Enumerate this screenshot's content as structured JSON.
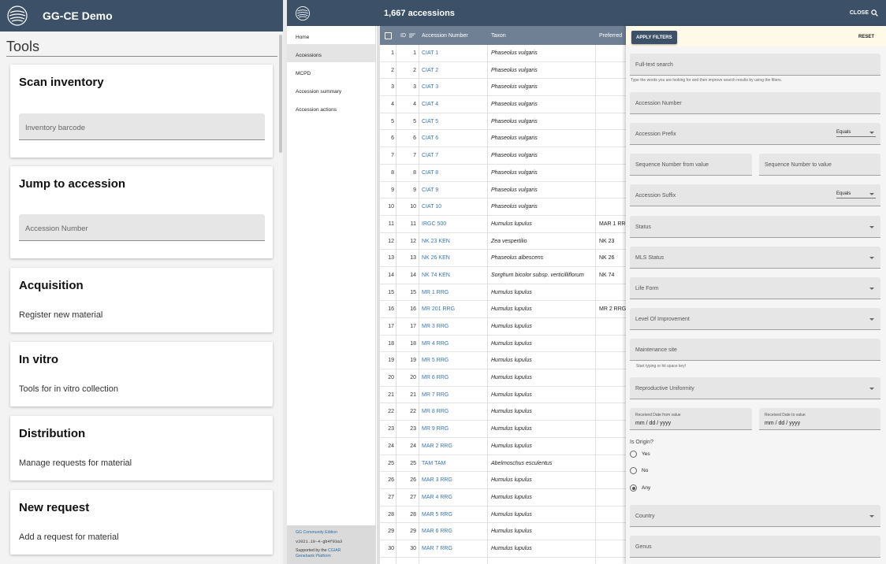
{
  "left": {
    "app_title": "GG-CE Demo",
    "section_title": "Tools",
    "cards": [
      {
        "title": "Scan inventory",
        "field_placeholder": "Inventory barcode"
      },
      {
        "title": "Jump to accession",
        "field_placeholder": "Accession Number"
      },
      {
        "title": "Acquisition",
        "subtitle": "Register new material"
      },
      {
        "title": "In vitro",
        "subtitle": "Tools for in vitro collection"
      },
      {
        "title": "Distribution",
        "subtitle": "Manage requests for material"
      },
      {
        "title": "New request",
        "subtitle": "Add a request for material"
      }
    ]
  },
  "right": {
    "accession_count": "1,667 accessions",
    "close_label": "CLOSE",
    "nav": [
      "Home",
      "Accessions",
      "MCPD",
      "Accession summary",
      "Accession actions"
    ],
    "footer": {
      "edition": "GG Community Edition",
      "version": "v2021.10-4-gb4f93a3",
      "supported_prefix": "Supported by the",
      "supported_accent": "CGIAR",
      "supported_line2": "Genebank Platform"
    },
    "table": {
      "headers": {
        "id": "ID",
        "accession": "Accession Number",
        "taxon": "Taxon",
        "preferred": "Preferred"
      },
      "rows": [
        {
          "n": "1",
          "id": "1",
          "acc": "CIAT 1",
          "taxon": "Phaseolus vulgaris",
          "pref": ""
        },
        {
          "n": "2",
          "id": "2",
          "acc": "CIAT 2",
          "taxon": "Phaseolus vulgaris",
          "pref": ""
        },
        {
          "n": "3",
          "id": "3",
          "acc": "CIAT 3",
          "taxon": "Phaseolus vulgaris",
          "pref": ""
        },
        {
          "n": "4",
          "id": "4",
          "acc": "CIAT 4",
          "taxon": "Phaseolus vulgaris",
          "pref": ""
        },
        {
          "n": "5",
          "id": "5",
          "acc": "CIAT 5",
          "taxon": "Phaseolus vulgaris",
          "pref": ""
        },
        {
          "n": "6",
          "id": "6",
          "acc": "CIAT 6",
          "taxon": "Phaseolus vulgaris",
          "pref": ""
        },
        {
          "n": "7",
          "id": "7",
          "acc": "CIAT 7",
          "taxon": "Phaseolus vulgaris",
          "pref": ""
        },
        {
          "n": "8",
          "id": "8",
          "acc": "CIAT 8",
          "taxon": "Phaseolus vulgaris",
          "pref": ""
        },
        {
          "n": "9",
          "id": "9",
          "acc": "CIAT 9",
          "taxon": "Phaseolus vulgaris",
          "pref": ""
        },
        {
          "n": "10",
          "id": "10",
          "acc": "CIAT 10",
          "taxon": "Phaseolus vulgaris",
          "pref": ""
        },
        {
          "n": "11",
          "id": "11",
          "acc": "IRGC 500",
          "taxon": "Humulus lupulus",
          "pref": "MAR 1 RRG"
        },
        {
          "n": "12",
          "id": "12",
          "acc": "NK 23 KEN",
          "taxon": "Zea vespertilio",
          "pref": "NK 23"
        },
        {
          "n": "13",
          "id": "13",
          "acc": "NK 26 KEN",
          "taxon": "Phaseolus albescens",
          "pref": "NK 26"
        },
        {
          "n": "14",
          "id": "14",
          "acc": "NK 74 KEN",
          "taxon": "Sorghum bicolor subsp. verticilliflorum",
          "pref": "NK 74"
        },
        {
          "n": "15",
          "id": "15",
          "acc": "MR 1 RRG",
          "taxon": "Humulus lupulus",
          "pref": ""
        },
        {
          "n": "16",
          "id": "16",
          "acc": "MR 201 RRG",
          "taxon": "Humulus lupulus",
          "pref": "MR 2 RRG"
        },
        {
          "n": "17",
          "id": "17",
          "acc": "MR 3 RRG",
          "taxon": "Humulus lupulus",
          "pref": ""
        },
        {
          "n": "18",
          "id": "18",
          "acc": "MR 4 RRG",
          "taxon": "Humulus lupulus",
          "pref": ""
        },
        {
          "n": "19",
          "id": "19",
          "acc": "MR 5 RRG",
          "taxon": "Humulus lupulus",
          "pref": ""
        },
        {
          "n": "20",
          "id": "20",
          "acc": "MR 6 RRG",
          "taxon": "Humulus lupulus",
          "pref": ""
        },
        {
          "n": "21",
          "id": "21",
          "acc": "MR 7 RRG",
          "taxon": "Humulus lupulus",
          "pref": ""
        },
        {
          "n": "22",
          "id": "22",
          "acc": "MR 8 RRG",
          "taxon": "Humulus lupulus",
          "pref": ""
        },
        {
          "n": "23",
          "id": "23",
          "acc": "MR 9 RRG",
          "taxon": "Humulus lupulus",
          "pref": ""
        },
        {
          "n": "24",
          "id": "24",
          "acc": "MAR 2 RRG",
          "taxon": "Humulus lupulus",
          "pref": ""
        },
        {
          "n": "25",
          "id": "25",
          "acc": "TAM TAM",
          "taxon": "Abelmoschus esculentus",
          "pref": ""
        },
        {
          "n": "26",
          "id": "26",
          "acc": "MAR 3 RRG",
          "taxon": "Humulus lupulus",
          "pref": ""
        },
        {
          "n": "27",
          "id": "27",
          "acc": "MAR 4 RRG",
          "taxon": "Humulus lupulus",
          "pref": ""
        },
        {
          "n": "28",
          "id": "28",
          "acc": "MAR 5 RRG",
          "taxon": "Humulus lupulus",
          "pref": ""
        },
        {
          "n": "29",
          "id": "29",
          "acc": "MAR 6 RRG",
          "taxon": "Humulus lupulus",
          "pref": ""
        },
        {
          "n": "30",
          "id": "30",
          "acc": "MAR 7 RRG",
          "taxon": "Humulus lupulus",
          "pref": ""
        }
      ]
    },
    "filters": {
      "apply_label": "APPLY FILTERS",
      "reset_label": "RESET",
      "fulltext": "Full-text search",
      "fulltext_hint": "Type the words you are looking for and then improve search results by using the filters.",
      "accession_number": "Accession Number",
      "accession_prefix": "Accession Prefix",
      "prefix_op": "Equals",
      "seq_from": "Sequence Number from value",
      "seq_to": "Sequence Number to value",
      "accession_suffix": "Accession Suffix",
      "suffix_op": "Equals",
      "status": "Status",
      "mls_status": "MLS Status",
      "life_form": "Life Form",
      "level_of_improvement": "Level Of Improvement",
      "maintenance_site": "Maintenance site",
      "maintenance_hint": "Start typing or hit space key!",
      "reproductive_uniformity": "Reproductive Uniformity",
      "received_from": "Received Date from value",
      "received_from_value": "mm / dd / yyyy",
      "received_to": "Received Date to value",
      "received_to_value": "mm / dd / yyyy",
      "is_origin": "Is Origin?",
      "origin_options": [
        "Yes",
        "No",
        "Any"
      ],
      "origin_selected": "Any",
      "country": "Country",
      "genus": "Genus"
    }
  }
}
